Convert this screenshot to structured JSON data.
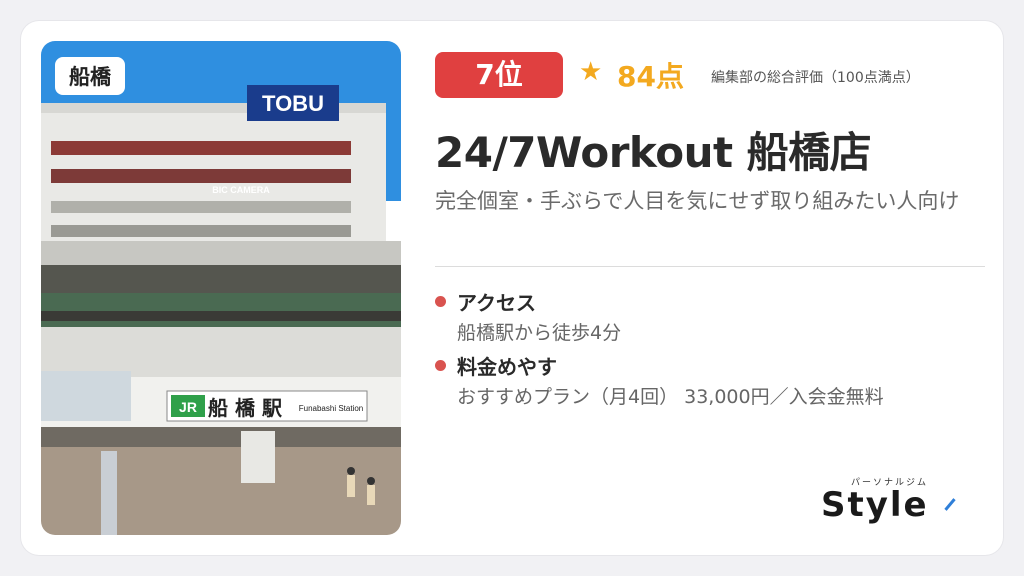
{
  "photo": {
    "location_badge": "船橋",
    "sign_store": "TOBU",
    "sign_tenant": "BIC CAMERA",
    "sign_station_jp": "船 橋 駅",
    "sign_station_en": "Funabashi Station",
    "sign_jr": "JR"
  },
  "rank": {
    "label": "7位"
  },
  "rating": {
    "star": "★",
    "score": "84点",
    "note": "編集部の総合評価（100点満点）"
  },
  "title": "24/7Workout 船橋店",
  "subtitle": "完全個室・手ぶらで人目を気にせず取り組みたい人向け",
  "items": [
    {
      "label": "アクセス",
      "value": "船橋駅から徒歩4分"
    },
    {
      "label": "料金めやす",
      "value": "おすすめプラン（月4回） 33,000円／入会金無料"
    }
  ],
  "logo": {
    "small": "パーソナルジム",
    "main": "Style"
  },
  "colors": {
    "accent_red": "#e04040",
    "star_gold": "#f3a91f",
    "bullet": "#d9534f"
  }
}
